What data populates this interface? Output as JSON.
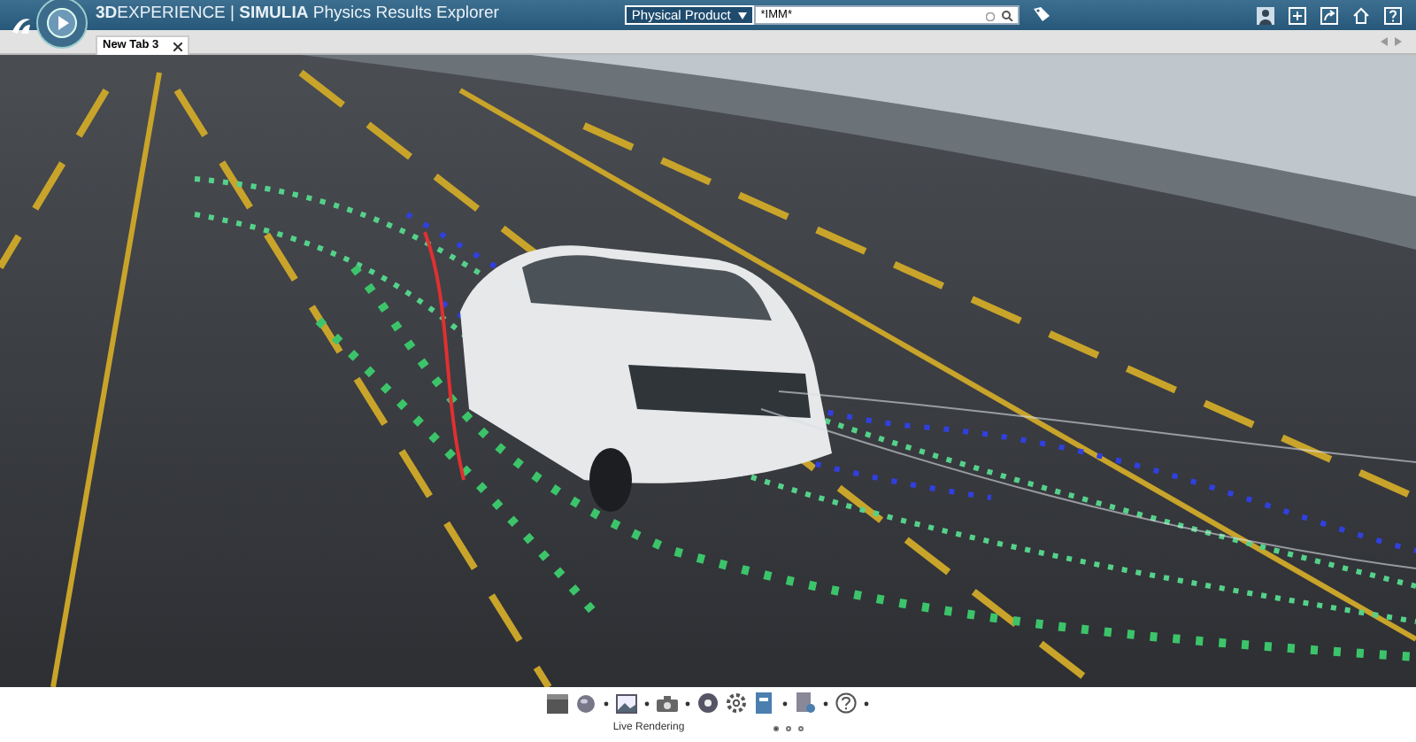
{
  "app_bar": {
    "title": "**3D**EXPERIENCE | **SIMULIA** Physics Results Explorer",
    "search": {
      "scope": "Physical Product",
      "value": "*IMM*"
    }
  },
  "tabs": [
    {
      "label": "New Tab 3",
      "selected": true
    }
  ],
  "toolbar": {
    "section_label": "Live Rendering",
    "pages": [
      {
        "selected": true
      },
      {
        "selected": false
      },
      {
        "selected": false
      }
    ]
  }
}
